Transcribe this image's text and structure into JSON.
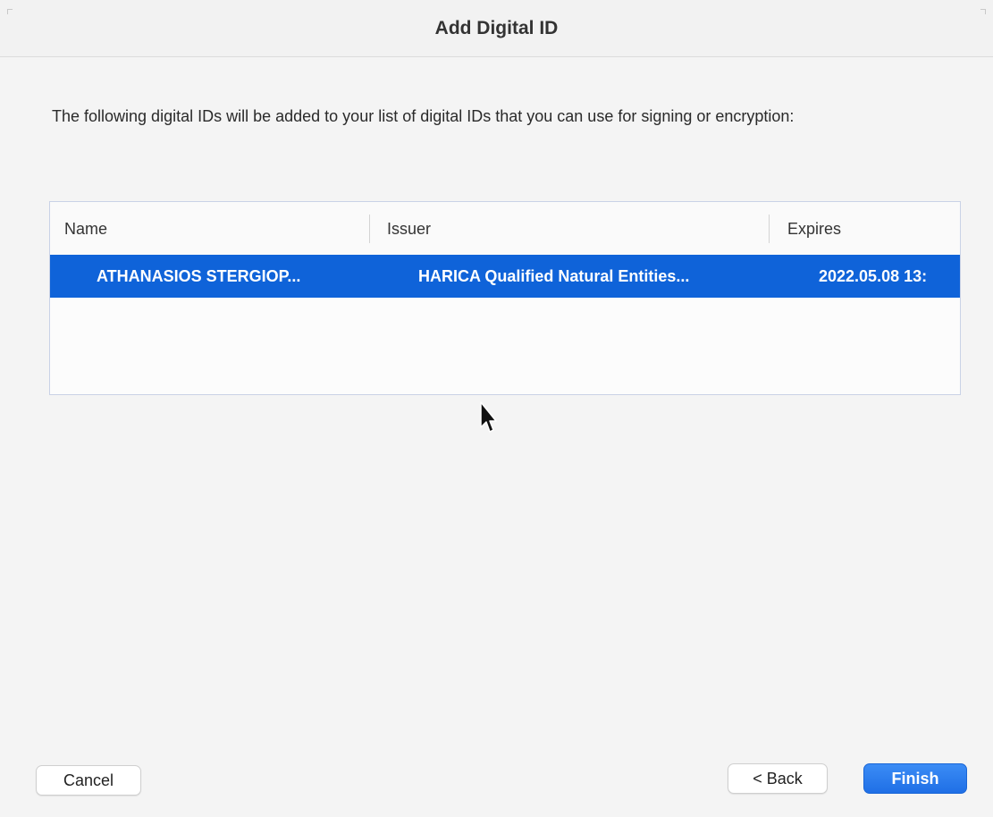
{
  "dialog": {
    "title": "Add Digital ID",
    "message": "The following digital IDs will be added to your list of digital IDs that you can use for signing or encryption:"
  },
  "table": {
    "columns": {
      "name": "Name",
      "issuer": "Issuer",
      "expires": "Expires"
    },
    "rows": [
      {
        "name": "ATHANASIOS STERGIOP...",
        "issuer": "HARICA Qualified Natural Entities...",
        "expires": "2022.05.08 13:",
        "selected": true
      }
    ]
  },
  "buttons": {
    "cancel": "Cancel",
    "back": "< Back",
    "finish": "Finish"
  },
  "colors": {
    "selection": "#0f63d9",
    "primary_button": "#2a7ef0"
  },
  "icons": {
    "cursor": "arrow-pointer-icon"
  }
}
